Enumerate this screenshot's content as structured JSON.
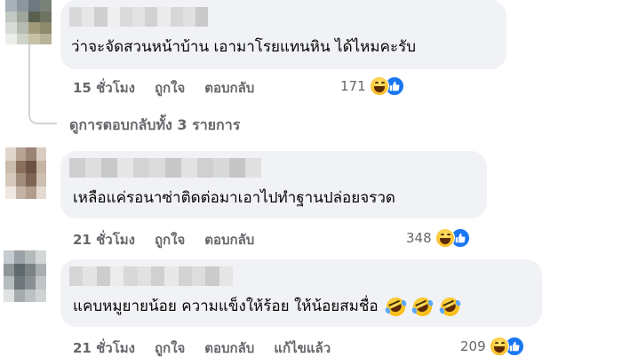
{
  "comments": [
    {
      "text": "ว่าจะจัดสวนหน้าบ้าน เอามาโรยแทนหิน ได้ไหมคะรับ",
      "time": "15 ชั่วโมง",
      "like": "ถูกใจ",
      "reply": "ตอบกลับ",
      "reaction_count": "171",
      "reactions": [
        "haha-emoji",
        "like-emoji"
      ],
      "avatar_colors": [
        "#a8b0b8",
        "#8e969d",
        "#6e7880",
        "#7a8278",
        "#c2c8c2",
        "#9ea59a",
        "#58604f",
        "#6d735f",
        "#d8dcd6",
        "#b6bdb0",
        "#a19a7a",
        "#8d8a6b",
        "#eceee9",
        "#cfd3c9",
        "#c7c2a5",
        "#b8b398"
      ],
      "name_blur_colors": [
        "#d9d9d9",
        "#e6e6e6",
        "#cfcfcf",
        "#efefef",
        "#dadada",
        "#e3e3e3",
        "#d2d2d2",
        "#ebebeb",
        "#d6d6d6",
        "#e0e0e0",
        "#cacaca"
      ]
    },
    {
      "text": "เหลือแค่รอนาซ่าติดต่อมาเอาไปทำฐานปล่อยจรวด",
      "time": "21 ชั่วโมง",
      "like": "ถูกใจ",
      "reply": "ตอบกลับ",
      "reaction_count": "348",
      "reactions": [
        "haha-emoji",
        "like-emoji"
      ],
      "avatar_colors": [
        "#e0d6cc",
        "#b8a494",
        "#9c8474",
        "#d9ccc0",
        "#cbbcae",
        "#8a6f5c",
        "#6b5242",
        "#c7b5a4",
        "#d6c8bb",
        "#a38d7c",
        "#7e6554",
        "#cdbfb1",
        "#efe8e2",
        "#c4b3a4",
        "#b29c8b",
        "#e4dbd2"
      ],
      "name_blur_colors": [
        "#cfcfcf",
        "#dedede",
        "#c9c9c9",
        "#e6e6e6",
        "#d4d4d4",
        "#dcdcdc",
        "#c8c8c8",
        "#e2e2e2",
        "#d0d0d0",
        "#d9d9d9",
        "#c6c6c6",
        "#e0e0e0"
      ]
    },
    {
      "text": "แคบหมูยายน้อย ความแข็งให้ร้อย ให้น้อยสมชื่อ",
      "time": "21 ชั่วโมง",
      "like": "ถูกใจ",
      "reply": "ตอบกลับ",
      "edited": "แก้ไขแล้ว",
      "reaction_count": "209",
      "reactions": [
        "haha-emoji",
        "like-emoji"
      ],
      "text_emojis": [
        "rofl-emoji",
        "rofl-emoji",
        "rofl-emoji"
      ],
      "avatar_colors": [
        "#c6cbcf",
        "#9ba3a6",
        "#b4b9ba",
        "#d4d7d8",
        "#8e9698",
        "#5f6a6d",
        "#7d8385",
        "#a9afb1",
        "#b7bcbe",
        "#6f777a",
        "#899093",
        "#c1c5c7",
        "#dfe2e3",
        "#a5abad",
        "#bcc1c3",
        "#cfd3d4"
      ],
      "name_blur_colors": [
        "#d6d6d6",
        "#e4e4e4",
        "#cdcdcd",
        "#ececec",
        "#d8d8d8",
        "#e1e1e1",
        "#d0d0d0",
        "#e8e8e8",
        "#d3d3d3",
        "#dddddd",
        "#cbcbcb",
        "#e5e5e5"
      ]
    }
  ],
  "view_replies": "ดูการตอบกลับทั้ง 3 รายการ",
  "colors": {
    "bubble": "#f0f2f5",
    "meta_text": "#65676b",
    "like_blue": "#1877f2",
    "thread_line": "#d0d3d8"
  }
}
